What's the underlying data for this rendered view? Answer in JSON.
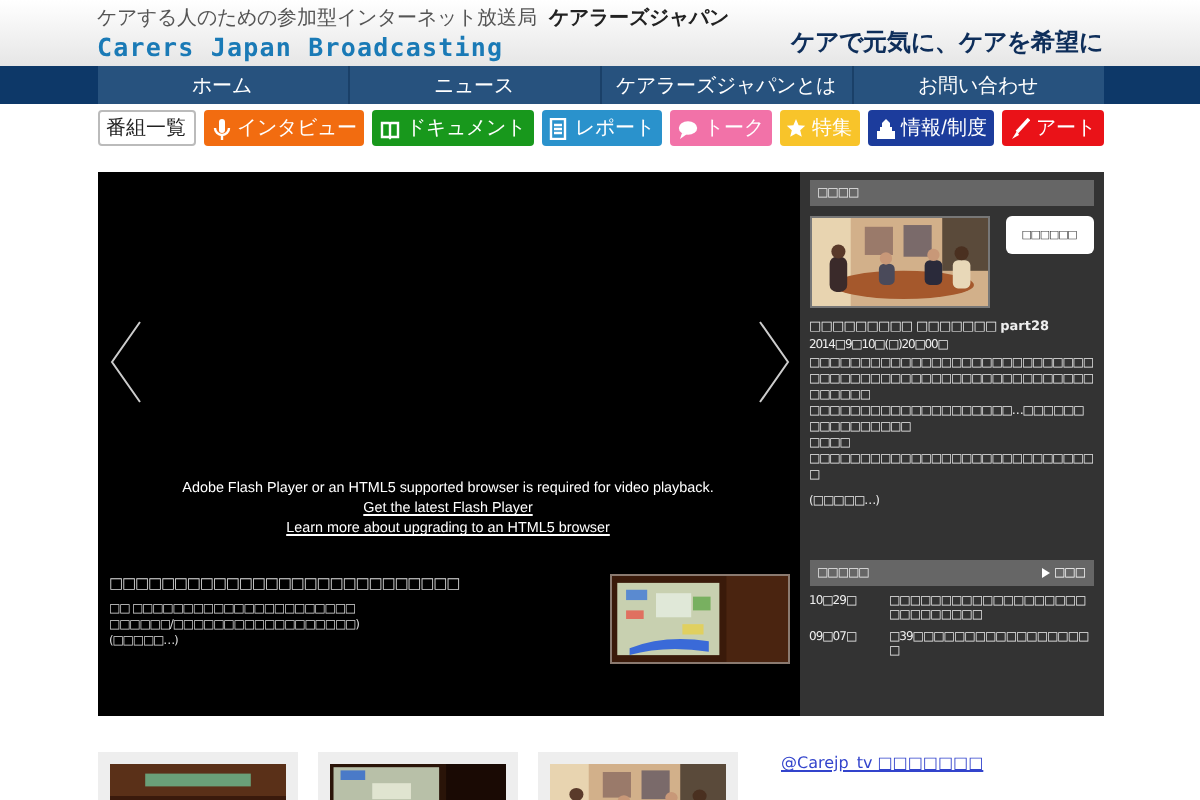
{
  "header": {
    "tagline": "ケアする人のための参加型インターネット放送局",
    "site_name": "ケアラーズジャパン",
    "logo": "Carers Japan Broadcasting",
    "slogan": "ケアで元気に、ケアを希望に"
  },
  "nav": [
    "ホーム",
    "ニュース",
    "ケアラーズジャパンとは",
    "お問い合わせ"
  ],
  "categories": [
    {
      "label": "番組一覧",
      "kind": "plain",
      "color": "#ffffff"
    },
    {
      "label": "インタビュー",
      "kind": "mic",
      "color": "#f26c10"
    },
    {
      "label": "ドキュメント",
      "kind": "book",
      "color": "#18981c"
    },
    {
      "label": "レポート",
      "kind": "doc",
      "color": "#2a92cc"
    },
    {
      "label": "トーク",
      "kind": "chat",
      "color": "#f272a8"
    },
    {
      "label": "特集",
      "kind": "star",
      "color": "#f8c42a"
    },
    {
      "label": "情報/制度",
      "kind": "building",
      "color": "#1c3c9c"
    },
    {
      "label": "アート",
      "kind": "brush",
      "color": "#ea1218"
    }
  ],
  "player": {
    "message": "Adobe Flash Player or an HTML5 supported browser is required for video playback.",
    "links": [
      "Get the latest Flash Player",
      "Learn more about upgrading to an HTML5 browser"
    ],
    "caption": {
      "title": "□□□□□□□□□□□□□□□□□□□□□□□□□□□",
      "lines": [
        "□□ □□□□□□□□□□□□□□□□□□□□□□",
        "□□□□□□/□□□□□□□□□□□□□□□□□□)"
      ],
      "more": "(□□□□□…)",
      "thumbnail": {
        "kind": "picture"
      }
    }
  },
  "sidebar": {
    "featured": {
      "heading": "□□□□",
      "thumbnail": {
        "kind": "picture"
      },
      "button": "□□□□□□",
      "title": "□□□□□□□□□ □□□□□□□ **part28**",
      "date": "2014□9□10□(□)20□00□",
      "body": [
        "□□□□□□□□□□□□□□□□□□□□□□□□□□□□",
        "□□□□□□□□□□□□□□□□□□□□□□□□□□□□□□□□□□",
        "□□□□□□□□□□□□□□□□□□□□…□□□□□□□□□□□□□□□□",
        "□□□□",
        "□□□□□□□□□□□□□□□□□□□□□□□□□□□□□"
      ],
      "more": "(□□□□□…)"
    },
    "news": {
      "heading": "□□□□□",
      "more_link": "□□□",
      "items": [
        {
          "date": "10□29□",
          "text": "□□□□□□□□□□□□□□□□□□□□□□□□□□□□"
        },
        {
          "date": "09□07□",
          "text": "□39□□□□□□□□□□□□□□□□□□"
        }
      ]
    }
  },
  "bottom": {
    "thumbnails": [
      {
        "kind": "picture"
      },
      {
        "kind": "picture"
      },
      {
        "kind": "picture"
      }
    ],
    "twitter_link": "@Carejp_tv □□□□□□□"
  }
}
